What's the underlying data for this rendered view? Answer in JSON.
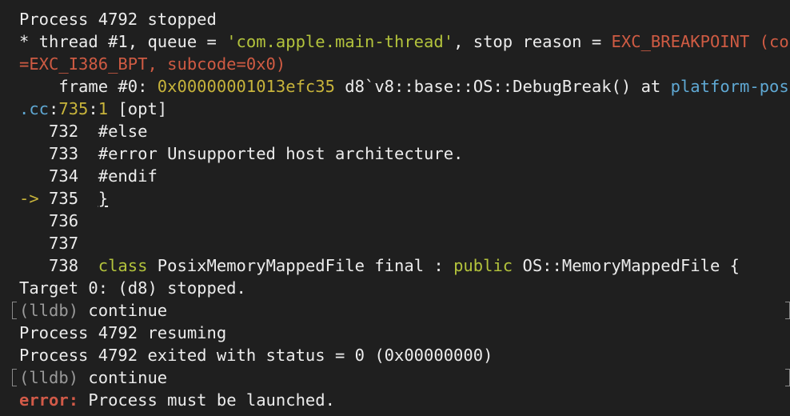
{
  "terminal": {
    "line1": "Process 4792 stopped",
    "line2": {
      "prefix": "* thread #1, queue = ",
      "queue": "'com.apple.main-thread'",
      "mid": ", stop reason = ",
      "reason": "EXC_BREAKPOINT (code"
    },
    "line3": "=EXC_I386_BPT, subcode=0x0)",
    "line4": {
      "prefix": "    frame #0: ",
      "addr": "0x00000001013efc35",
      "func": " d8`v8::base::OS::DebugBreak() at ",
      "file": "platform-posix"
    },
    "line5": {
      "file": ".cc",
      "colon1": ":",
      "line_no": "735",
      "colon2": ":",
      "col": "1",
      "rest": " [opt]"
    },
    "src": [
      {
        "marker": "   ",
        "num": "732",
        "text": "  #else"
      },
      {
        "marker": "   ",
        "num": "733",
        "text": "  #error Unsupported host architecture."
      },
      {
        "marker": "   ",
        "num": "734",
        "text": "  #endif"
      },
      {
        "marker": "-> ",
        "num": "735",
        "text": "  ",
        "cursor": "}"
      },
      {
        "marker": "   ",
        "num": "736",
        "text": ""
      },
      {
        "marker": "   ",
        "num": "737",
        "text": ""
      }
    ],
    "src738": {
      "head": "   738  ",
      "kw1": "class",
      "mid": " PosixMemoryMappedFile final : ",
      "kw2": "public",
      "tail": " OS::MemoryMappedFile {"
    },
    "target": "Target 0: (d8) stopped.",
    "prompt": "(lldb)",
    "cmd1": " continue",
    "resuming": "Process 4792 resuming",
    "exited": "Process 4792 exited with status = 0 (0x00000000)",
    "cmd2": " continue",
    "error_label": "error:",
    "error_msg": " Process must be launched.",
    "colors": {
      "background": "#1f1f1f",
      "foreground": "#ececec",
      "error": "#cf5b43",
      "string": "#b3c33c",
      "keyword": "#b3c33c",
      "address": "#c8b43b",
      "file": "#5fa8d3",
      "prompt": "#9a9a9a"
    }
  }
}
